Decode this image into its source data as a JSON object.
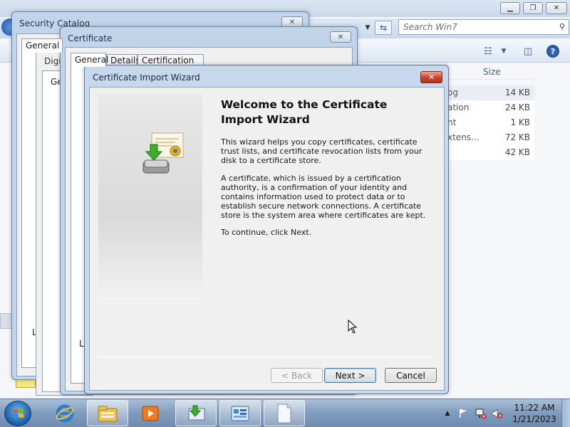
{
  "explorer": {
    "search_placeholder": "Search Win7",
    "column_size": "Size",
    "files": [
      {
        "name": "og",
        "size": "14 KB",
        "selected": true
      },
      {
        "name": "ation",
        "size": "24 KB",
        "selected": false
      },
      {
        "name": "nt",
        "size": "1 KB",
        "selected": false
      },
      {
        "name": "xtens...",
        "size": "72 KB",
        "selected": false
      },
      {
        "name": "",
        "size": "42 KB",
        "selected": false
      }
    ]
  },
  "security_catalog": {
    "title": "Security Catalog",
    "tab_general": "General",
    "frag_letter": "L"
  },
  "digital_signature": {
    "title_fragment": "Digi",
    "tab_fragment": "Ge"
  },
  "certificate": {
    "title": "Certificate",
    "tabs": [
      "General",
      "Details",
      "Certification Path"
    ],
    "frag_letter": "Le"
  },
  "wizard": {
    "title": "Certificate Import Wizard",
    "heading": "Welcome to the Certificate Import Wizard",
    "para1": "This wizard helps you copy certificates, certificate trust lists, and certificate revocation lists from your disk to a certificate store.",
    "para2": "A certificate, which is issued by a certification authority, is a confirmation of your identity and contains information used to protect data or to establish secure network connections. A certificate store is the system area where certificates are kept.",
    "para3": "To continue, click Next.",
    "back_label": "< Back",
    "next_label": "Next >",
    "cancel_label": "Cancel"
  },
  "taskbar": {
    "time": "11:22 AM",
    "date": "1/21/2023",
    "pinned_icons": [
      "internet-explorer-icon",
      "windows-explorer-icon",
      "media-player-icon",
      "certificate-import-icon",
      "control-panel-icon",
      "document-icon"
    ]
  },
  "colors": {
    "dialog_frame": "#c2d4ea",
    "close_red": "#c8402c",
    "taskbar": "#7f9bbd",
    "default_button_border": "#3c7fb1"
  }
}
